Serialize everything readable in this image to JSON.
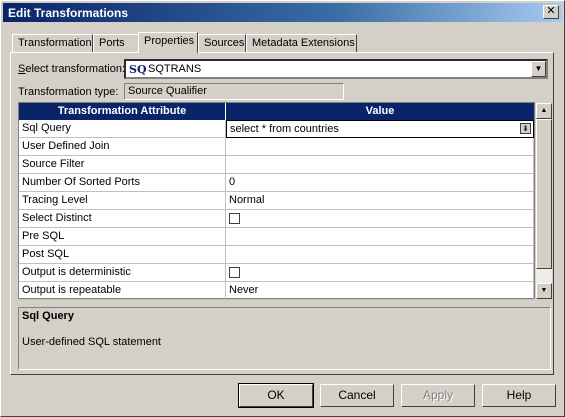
{
  "window": {
    "title": "Edit Transformations",
    "close_glyph": "✕"
  },
  "tabs": [
    {
      "label": "Transformation",
      "active": false
    },
    {
      "label": "Ports",
      "active": false
    },
    {
      "label": "Properties",
      "active": true
    },
    {
      "label": "Sources",
      "active": false
    },
    {
      "label": "Metadata Extensions",
      "active": false
    }
  ],
  "select_transformation": {
    "label_u": "S",
    "label_rest": "elect transformation:",
    "icon": "sq-transformation-icon",
    "icon_text": "SQ",
    "value": "SQTRANS",
    "arrow": "▼"
  },
  "transformation_type": {
    "label": "Transformation type:",
    "value": "Source Qualifier"
  },
  "grid": {
    "headers": [
      "Transformation Attribute",
      "Value"
    ],
    "rows": [
      {
        "attribute": "Sql Query",
        "value": "select * from countries",
        "has_button": true,
        "selected": true
      },
      {
        "attribute": "User Defined Join",
        "value": ""
      },
      {
        "attribute": "Source Filter",
        "value": ""
      },
      {
        "attribute": "Number Of Sorted Ports",
        "value": "0"
      },
      {
        "attribute": "Tracing Level",
        "value": "Normal"
      },
      {
        "attribute": "Select Distinct",
        "value": "",
        "checkbox": true,
        "checked": false
      },
      {
        "attribute": "Pre SQL",
        "value": ""
      },
      {
        "attribute": "Post SQL",
        "value": ""
      },
      {
        "attribute": "Output is deterministic",
        "value": "",
        "checkbox": true,
        "checked": false
      },
      {
        "attribute": "Output is repeatable",
        "value": "Never"
      }
    ],
    "cell_button_glyph": "⇟"
  },
  "scrollbar": {
    "up": "▲",
    "down": "▼"
  },
  "description": {
    "title": "Sql Query",
    "text": "User-defined SQL statement"
  },
  "buttons": {
    "ok": "OK",
    "cancel": "Cancel",
    "apply": "Apply",
    "help": "Help"
  }
}
